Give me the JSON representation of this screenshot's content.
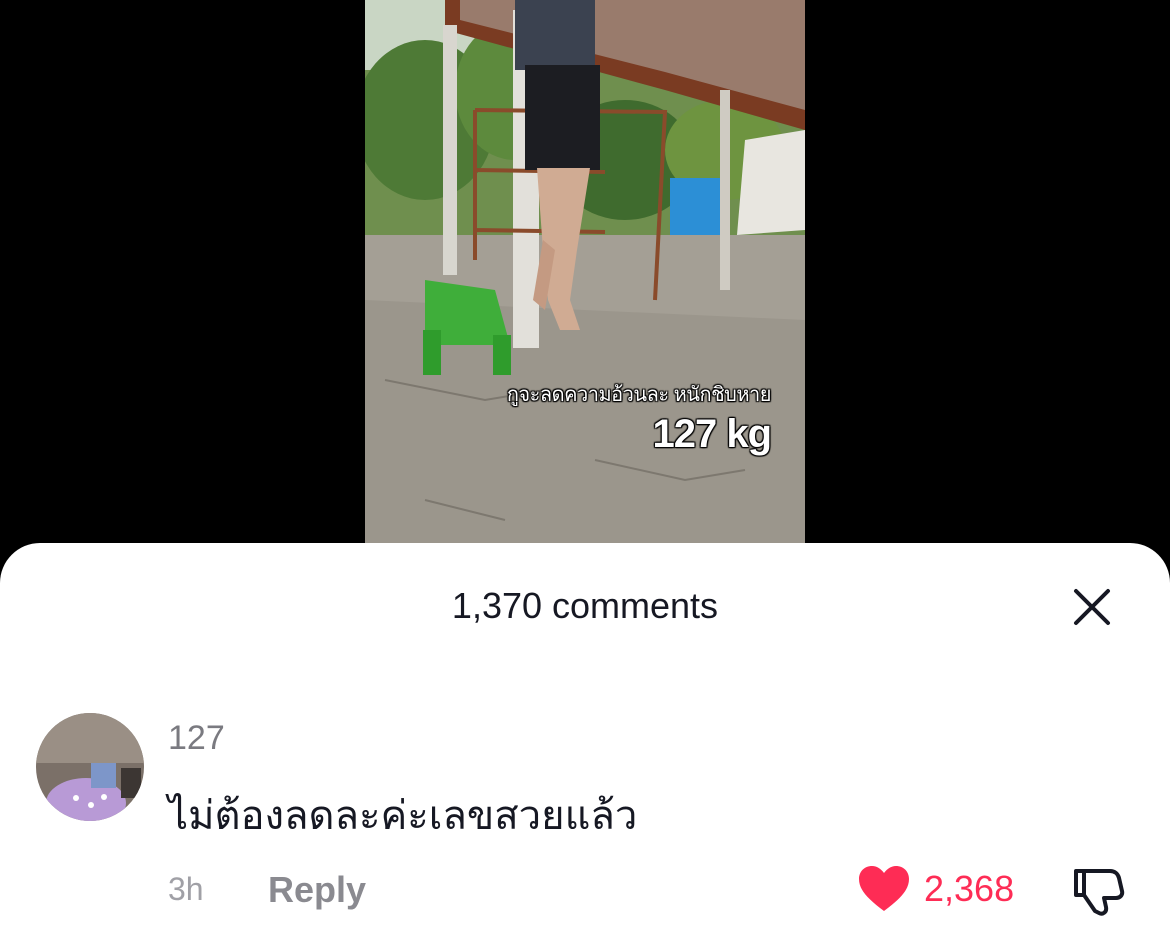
{
  "video": {
    "caption_line1": "กูจะลดความอ้วนละ หนักชิบหาย",
    "caption_line2": "127 kg"
  },
  "comments_sheet": {
    "title": "1,370 comments",
    "close_icon": "close-icon"
  },
  "comment": {
    "username": "127",
    "text": "ไม่ต้องลดละค่ะเลขสวยแล้ว",
    "time": "3h",
    "reply_label": "Reply",
    "like_count": "2,368",
    "liked": true,
    "like_icon": "heart-icon",
    "dislike_icon": "thumbs-down-icon"
  },
  "colors": {
    "accent": "#fe2c55",
    "text_primary": "#161823",
    "text_secondary": "#7a7a80",
    "background": "#000000",
    "sheet": "#ffffff"
  }
}
